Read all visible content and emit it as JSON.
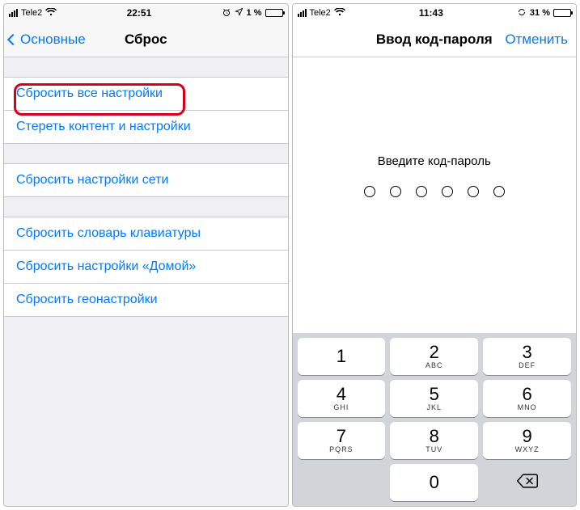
{
  "left": {
    "status": {
      "carrier": "Tele2",
      "time": "22:51",
      "battery_pct": "1 %",
      "alarm": "⏰",
      "location": "➤"
    },
    "nav": {
      "back_label": "Основные",
      "title": "Сброс"
    },
    "groups": [
      {
        "items": [
          {
            "id": "reset-all-settings",
            "label": "Сбросить все настройки",
            "highlighted": true
          },
          {
            "id": "erase-all-content",
            "label": "Стереть контент и настройки"
          }
        ]
      },
      {
        "items": [
          {
            "id": "reset-network-settings",
            "label": "Сбросить настройки сети"
          }
        ]
      },
      {
        "items": [
          {
            "id": "reset-keyboard-dictionary",
            "label": "Сбросить словарь клавиатуры"
          },
          {
            "id": "reset-home-layout",
            "label": "Сбросить настройки «Домой»"
          },
          {
            "id": "reset-location-settings",
            "label": "Сбросить геонастройки"
          }
        ]
      }
    ]
  },
  "right": {
    "status": {
      "carrier": "Tele2",
      "time": "11:43",
      "battery_pct": "31 %",
      "sync": "⟳"
    },
    "nav": {
      "title": "Ввод код-пароля",
      "cancel_label": "Отменить"
    },
    "prompt": "Введите код-пароль",
    "passcode_length": 6,
    "keypad": [
      {
        "digit": "1",
        "letters": ""
      },
      {
        "digit": "2",
        "letters": "ABC"
      },
      {
        "digit": "3",
        "letters": "DEF"
      },
      {
        "digit": "4",
        "letters": "GHI"
      },
      {
        "digit": "5",
        "letters": "JKL"
      },
      {
        "digit": "6",
        "letters": "MNO"
      },
      {
        "digit": "7",
        "letters": "PQRS"
      },
      {
        "digit": "8",
        "letters": "TUV"
      },
      {
        "digit": "9",
        "letters": "WXYZ"
      },
      {
        "blank": true
      },
      {
        "digit": "0",
        "letters": ""
      },
      {
        "backspace": true
      }
    ]
  }
}
